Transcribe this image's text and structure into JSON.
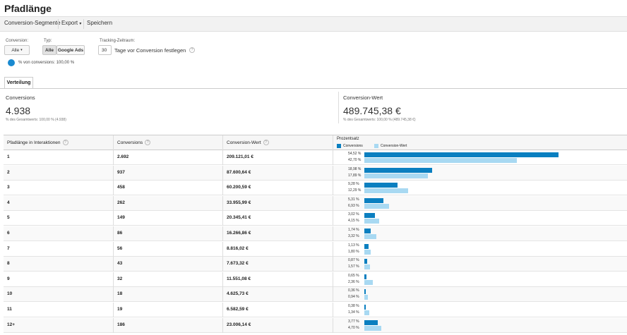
{
  "title": "Pfadlänge",
  "toolbar": {
    "segments_label": "Conversion-Segmente",
    "export_label": "Export",
    "save_label": "Speichern"
  },
  "controls": {
    "conversion_label": "Conversion:",
    "conversion_value": "Alle",
    "type_label": "Typ:",
    "type_all": "Alle",
    "type_google_ads": "Google Ads",
    "tracking_label": "Tracking-Zeitraum:",
    "tracking_days": "30",
    "tracking_suffix": "Tage vor Conversion festlegen",
    "segment_text": "% von conversions: 100,00 %",
    "segment_color": "#1a8ad0"
  },
  "tab_label": "Verteilung",
  "metrics": {
    "conversions_title": "Conversions",
    "conversions_value": "4.938",
    "conversions_sub": "% des Gesamtwerts: 100,00 % (4.938)",
    "value_title": "Conversion-Wert",
    "value_value": "489.745,38 €",
    "value_sub": "% des Gesamtwerts: 100,00 % (489.745,38 €)"
  },
  "table": {
    "headers": {
      "path": "Pfadlänge in Interaktionen",
      "conversions": "Conversions",
      "value": "Conversion-Wert",
      "percent": "Prozentsatz"
    },
    "legend": {
      "conversions": "Conversions",
      "value": "Conversion-Wert"
    },
    "colors": {
      "conversions": "#0a7fc0",
      "value": "#a8d9f2"
    },
    "rows": [
      {
        "path": "1",
        "conversions": "2.692",
        "value": "209.121,01 €",
        "pct_conv": "54,52 %",
        "pct_val": "42,70 %",
        "conv": 54.52,
        "val": 42.7
      },
      {
        "path": "2",
        "conversions": "937",
        "value": "87.600,64 €",
        "pct_conv": "18,98 %",
        "pct_val": "17,89 %",
        "conv": 18.98,
        "val": 17.89
      },
      {
        "path": "3",
        "conversions": "458",
        "value": "60.200,59 €",
        "pct_conv": "9,28 %",
        "pct_val": "12,29 %",
        "conv": 9.28,
        "val": 12.29
      },
      {
        "path": "4",
        "conversions": "262",
        "value": "33.955,99 €",
        "pct_conv": "5,31 %",
        "pct_val": "6,93 %",
        "conv": 5.31,
        "val": 6.93
      },
      {
        "path": "5",
        "conversions": "149",
        "value": "20.345,41 €",
        "pct_conv": "3,02 %",
        "pct_val": "4,15 %",
        "conv": 3.02,
        "val": 4.15
      },
      {
        "path": "6",
        "conversions": "86",
        "value": "16.266,86 €",
        "pct_conv": "1,74 %",
        "pct_val": "3,32 %",
        "conv": 1.74,
        "val": 3.32
      },
      {
        "path": "7",
        "conversions": "56",
        "value": "8.816,02 €",
        "pct_conv": "1,13 %",
        "pct_val": "1,80 %",
        "conv": 1.13,
        "val": 1.8
      },
      {
        "path": "8",
        "conversions": "43",
        "value": "7.673,32 €",
        "pct_conv": "0,87 %",
        "pct_val": "1,57 %",
        "conv": 0.87,
        "val": 1.57
      },
      {
        "path": "9",
        "conversions": "32",
        "value": "11.551,08 €",
        "pct_conv": "0,65 %",
        "pct_val": "2,36 %",
        "conv": 0.65,
        "val": 2.36
      },
      {
        "path": "10",
        "conversions": "18",
        "value": "4.625,73 €",
        "pct_conv": "0,36 %",
        "pct_val": "0,94 %",
        "conv": 0.36,
        "val": 0.94
      },
      {
        "path": "11",
        "conversions": "19",
        "value": "6.582,59 €",
        "pct_conv": "0,38 %",
        "pct_val": "1,34 %",
        "conv": 0.38,
        "val": 1.34
      },
      {
        "path": "12+",
        "conversions": "186",
        "value": "23.006,14 €",
        "pct_conv": "3,77 %",
        "pct_val": "4,70 %",
        "conv": 3.77,
        "val": 4.7
      }
    ]
  }
}
